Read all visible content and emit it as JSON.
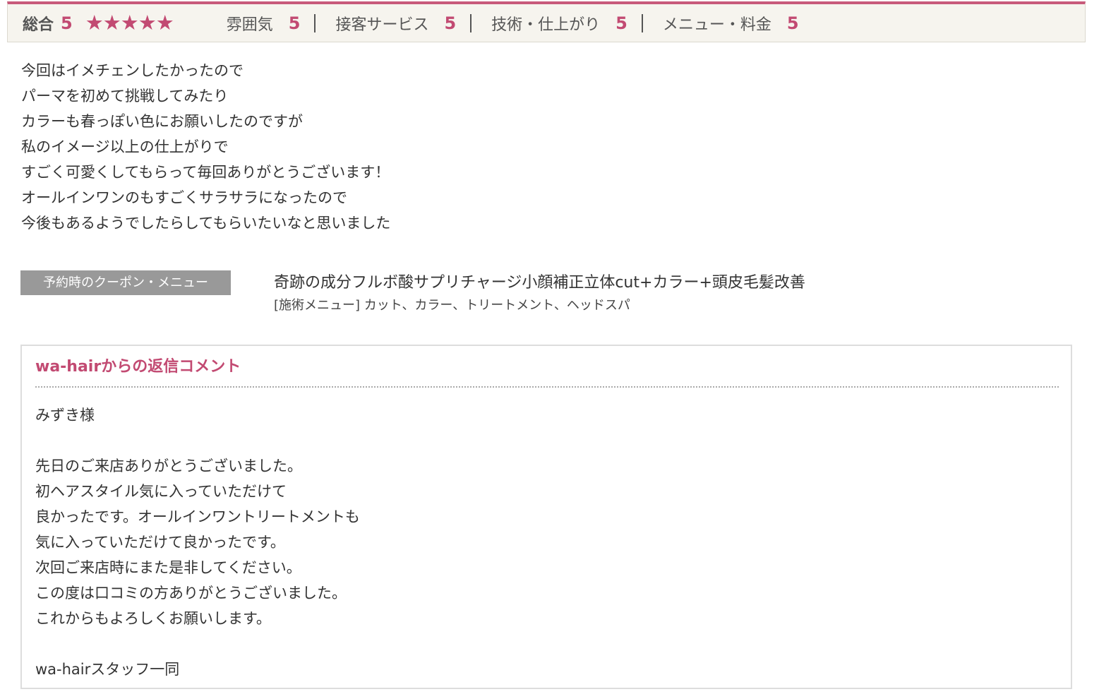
{
  "rating": {
    "overall_label": "総合",
    "overall_score": "5",
    "stars": [
      "★",
      "★",
      "★",
      "★",
      "★"
    ],
    "star_fraction": 1.0,
    "accent_color": "#c24a72",
    "categories": [
      {
        "label": "雰囲気",
        "score": "5"
      },
      {
        "label": "接客サービス",
        "score": "5"
      },
      {
        "label": "技術・仕上がり",
        "score": "5"
      },
      {
        "label": "メニュー・料金",
        "score": "5"
      }
    ]
  },
  "review": {
    "lines": [
      "今回はイメチェンしたかったので",
      "パーマを初めて挑戦してみたり",
      "カラーも春っぽい色にお願いしたのですが",
      "私のイメージ以上の仕上がりで",
      "すごく可愛くしてもらって毎回ありがとうございます！",
      "オールインワンのもすごくサラサラになったので",
      "今後もあるようでしたらしてもらいたいなと思いました"
    ]
  },
  "coupon": {
    "tag_label": "予約時のクーポン・メニュー",
    "name": "奇跡の成分フルボ酸サプリチャージ小顔補正立体cut+カラー+頭皮毛髪改善",
    "menu": "[施術メニュー] カット、カラー、トリートメント、ヘッドスパ"
  },
  "reply": {
    "title": "wa-hairからの返信コメント",
    "lines": [
      "みずき様",
      "",
      "先日のご来店ありがとうございました。",
      "初ヘアスタイル気に入っていただけて",
      "良かったです。オールインワントリートメントも",
      "気に入っていただけて良かったです。",
      "次回ご来店時にまた是非してください。",
      "この度は口コミの方ありがとうございました。",
      "これからもよろしくお願いします。",
      "",
      "wa-hairスタッフ一同"
    ]
  }
}
